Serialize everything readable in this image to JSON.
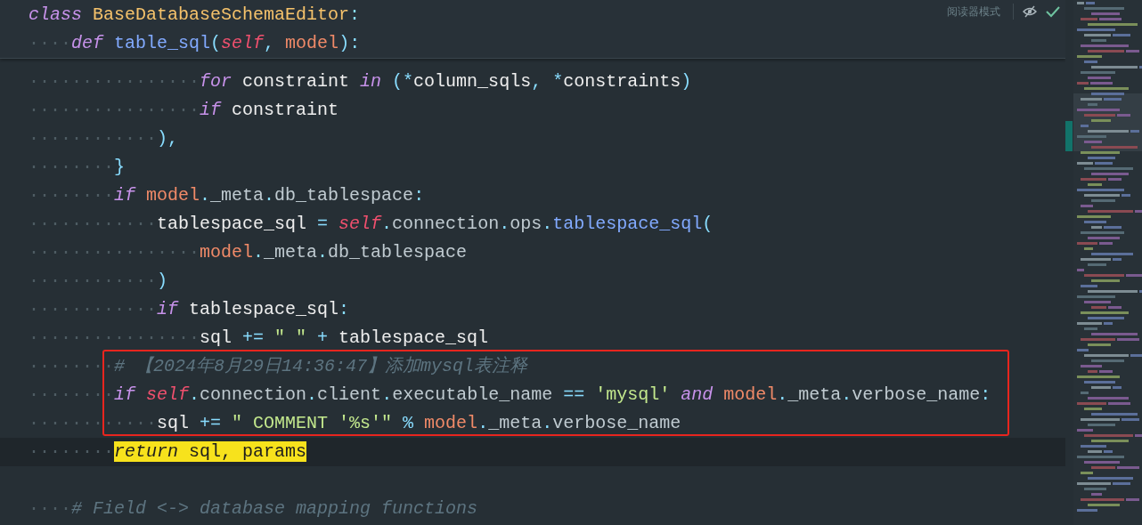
{
  "sticky_header": {
    "lines": [
      {
        "tokens": [
          {
            "kind": "kw",
            "text": "class"
          },
          {
            "kind": "cls",
            "text": " BaseDatabaseSchemaEditor"
          },
          {
            "kind": "punc",
            "text": ":"
          }
        ]
      },
      {
        "indent": "····",
        "tokens": [
          {
            "kind": "kw",
            "text": "def"
          },
          {
            "kind": "fn",
            "text": " table_sql"
          },
          {
            "kind": "punc",
            "text": "("
          },
          {
            "kind": "self",
            "text": "self"
          },
          {
            "kind": "punc",
            "text": ", "
          },
          {
            "kind": "param",
            "text": "model"
          },
          {
            "kind": "punc",
            "text": "):"
          }
        ]
      }
    ]
  },
  "reader_mode": {
    "label": "阅读器模式"
  },
  "lines": [
    {
      "kind": "code",
      "indent": "················",
      "tokens": [
        {
          "kind": "kw",
          "text": "for"
        },
        {
          "kind": "id",
          "text": " constraint "
        },
        {
          "kind": "kw",
          "text": "in"
        },
        {
          "kind": "punc",
          "text": " (*"
        },
        {
          "kind": "id",
          "text": "column_sqls"
        },
        {
          "kind": "punc",
          "text": ", *"
        },
        {
          "kind": "id",
          "text": "constraints"
        },
        {
          "kind": "punc",
          "text": ")"
        }
      ]
    },
    {
      "kind": "code",
      "indent": "················",
      "tokens": [
        {
          "kind": "kw",
          "text": "if"
        },
        {
          "kind": "id",
          "text": " constraint"
        }
      ]
    },
    {
      "kind": "code",
      "indent": "············",
      "tokens": [
        {
          "kind": "punc",
          "text": "),"
        }
      ]
    },
    {
      "kind": "code",
      "indent": "········",
      "tokens": [
        {
          "kind": "punc",
          "text": "}"
        }
      ]
    },
    {
      "kind": "code",
      "indent": "········",
      "tokens": [
        {
          "kind": "kw",
          "text": "if"
        },
        {
          "kind": "param",
          "text": " model"
        },
        {
          "kind": "punc",
          "text": "."
        },
        {
          "kind": "attr",
          "text": "_meta"
        },
        {
          "kind": "punc",
          "text": "."
        },
        {
          "kind": "attr",
          "text": "db_tablespace"
        },
        {
          "kind": "punc",
          "text": ":"
        }
      ]
    },
    {
      "kind": "code",
      "indent": "············",
      "tokens": [
        {
          "kind": "id",
          "text": "tablespace_sql "
        },
        {
          "kind": "punc",
          "text": "="
        },
        {
          "kind": "self",
          "text": " self"
        },
        {
          "kind": "punc",
          "text": "."
        },
        {
          "kind": "attr",
          "text": "connection"
        },
        {
          "kind": "punc",
          "text": "."
        },
        {
          "kind": "attr",
          "text": "ops"
        },
        {
          "kind": "punc",
          "text": "."
        },
        {
          "kind": "fn",
          "text": "tablespace_sql"
        },
        {
          "kind": "punc",
          "text": "("
        }
      ]
    },
    {
      "kind": "code",
      "indent": "················",
      "tokens": [
        {
          "kind": "param",
          "text": "model"
        },
        {
          "kind": "punc",
          "text": "."
        },
        {
          "kind": "attr",
          "text": "_meta"
        },
        {
          "kind": "punc",
          "text": "."
        },
        {
          "kind": "attr",
          "text": "db_tablespace"
        }
      ]
    },
    {
      "kind": "code",
      "indent": "············",
      "tokens": [
        {
          "kind": "punc",
          "text": ")"
        }
      ]
    },
    {
      "kind": "code",
      "indent": "············",
      "tokens": [
        {
          "kind": "kw",
          "text": "if"
        },
        {
          "kind": "id",
          "text": " tablespace_sql"
        },
        {
          "kind": "punc",
          "text": ":"
        }
      ]
    },
    {
      "kind": "code",
      "indent": "················",
      "tokens": [
        {
          "kind": "id",
          "text": "sql "
        },
        {
          "kind": "punc",
          "text": "+="
        },
        {
          "kind": "str",
          "text": " \" \""
        },
        {
          "kind": "punc",
          "text": " +"
        },
        {
          "kind": "id",
          "text": " tablespace_sql"
        }
      ]
    },
    {
      "kind": "code",
      "indent": "········",
      "boxed": true,
      "tokens": [
        {
          "kind": "cmt",
          "text": "# 【2024年8月29日14:36:47】添加mysql表注释"
        }
      ]
    },
    {
      "kind": "code",
      "indent": "········",
      "boxed": true,
      "tokens": [
        {
          "kind": "kw",
          "text": "if"
        },
        {
          "kind": "self",
          "text": " self"
        },
        {
          "kind": "punc",
          "text": "."
        },
        {
          "kind": "attr",
          "text": "connection"
        },
        {
          "kind": "punc",
          "text": "."
        },
        {
          "kind": "attr",
          "text": "client"
        },
        {
          "kind": "punc",
          "text": "."
        },
        {
          "kind": "attr",
          "text": "executable_name"
        },
        {
          "kind": "punc",
          "text": " =="
        },
        {
          "kind": "str",
          "text": " 'mysql'"
        },
        {
          "kind": "kw",
          "text": " and"
        },
        {
          "kind": "param",
          "text": " model"
        },
        {
          "kind": "punc",
          "text": "."
        },
        {
          "kind": "attr",
          "text": "_meta"
        },
        {
          "kind": "punc",
          "text": "."
        },
        {
          "kind": "attr",
          "text": "verbose_name"
        },
        {
          "kind": "punc",
          "text": ":"
        }
      ]
    },
    {
      "kind": "code",
      "indent": "············",
      "boxed": true,
      "tokens": [
        {
          "kind": "id",
          "text": "sql "
        },
        {
          "kind": "punc",
          "text": "+="
        },
        {
          "kind": "str",
          "text": " \" COMMENT '%s'\""
        },
        {
          "kind": "punc",
          "text": " %"
        },
        {
          "kind": "param",
          "text": " model"
        },
        {
          "kind": "punc",
          "text": "."
        },
        {
          "kind": "attr",
          "text": "_meta"
        },
        {
          "kind": "punc",
          "text": "."
        },
        {
          "kind": "attr",
          "text": "verbose_name"
        }
      ]
    },
    {
      "kind": "code",
      "indent": "········",
      "current": true,
      "highlighted": true,
      "tokens": [
        {
          "kind": "kw",
          "text": "return"
        },
        {
          "kind": "id",
          "text": " sql, params"
        }
      ]
    },
    {
      "kind": "blank"
    },
    {
      "kind": "code",
      "indent": "····",
      "tokens": [
        {
          "kind": "cmt",
          "text": "# Field <-> database mapping functions"
        }
      ]
    }
  ]
}
